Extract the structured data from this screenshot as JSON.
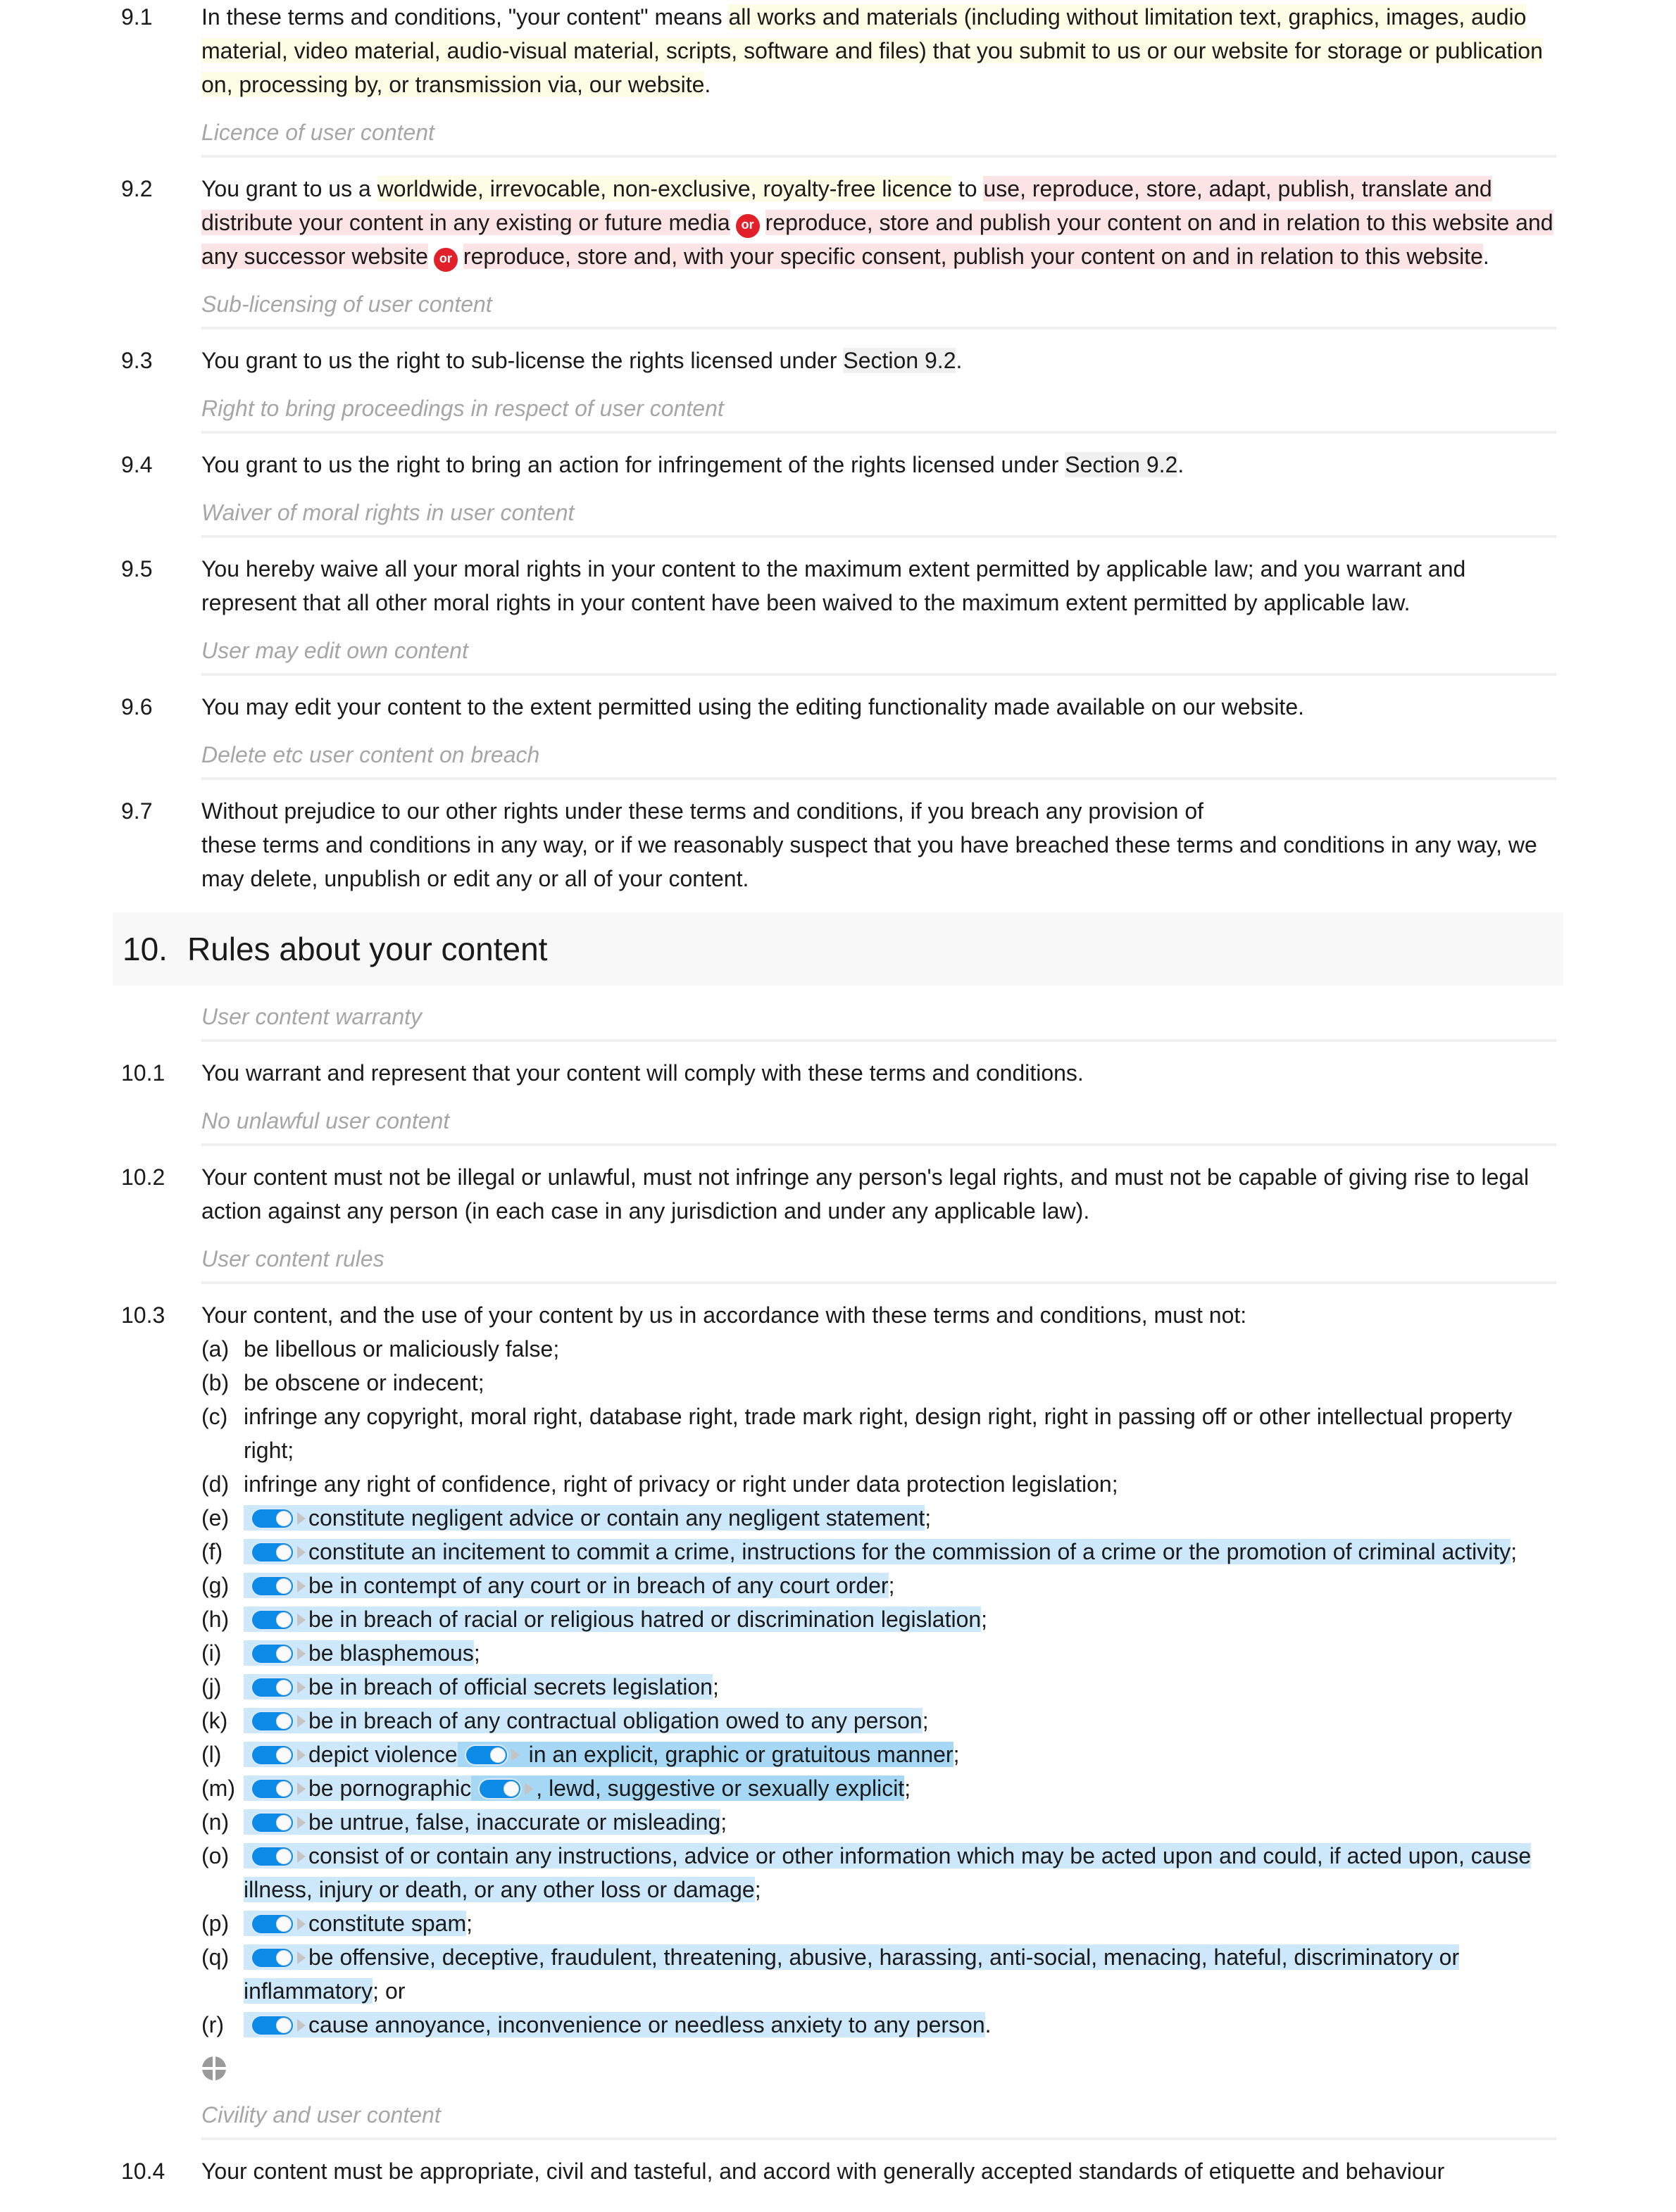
{
  "section9": {
    "clauses": [
      {
        "num": "9.1",
        "pre": "In these terms and conditions, \"your content\" means ",
        "hl": "all works and materials (including without limitation text, graphics, images, audio material, video material, audio-visual material, scripts, software and files) that you submit to us or our website for storage or publication on, processing by, or transmission via, our website",
        "post": "."
      },
      {
        "caption": "Licence of user content",
        "num": "9.2",
        "pre": "You grant to us a ",
        "hl_yellow": "worldwide, irrevocable, non-exclusive, royalty-free licence",
        "mid": " to ",
        "option1": "use, reproduce, store, adapt, publish, translate and distribute your content in any existing or future media",
        "or_label": "or",
        "option2": "reproduce, store and publish your content on and in relation to this website and any successor website",
        "option3": "reproduce, store and, with your specific consent, publish your content on and in relation to this website",
        "post": "."
      },
      {
        "caption": "Sub-licensing of user content",
        "num": "9.3",
        "pre": "You grant to us the right to sub-license the rights licensed under ",
        "xref": "Section 9.2",
        "post": "."
      },
      {
        "caption": "Right to bring proceedings in respect of user content",
        "num": "9.4",
        "pre": "You grant to us the right to bring an action for infringement of the rights licensed under ",
        "xref": "Section 9.2",
        "post": "."
      },
      {
        "caption": "Waiver of moral rights in user content",
        "num": "9.5",
        "text": "You hereby waive all your moral rights in your content to the maximum extent permitted by applicable law; and you warrant and represent that all other moral rights in your content have been waived to the maximum extent permitted by applicable law."
      },
      {
        "caption": "User may edit own content",
        "num": "9.6",
        "text": "You may edit your content to the extent permitted using the editing functionality made available on our website."
      },
      {
        "caption": "Delete etc user content on breach",
        "num": "9.7",
        "line1": "Without prejudice to our other rights under these terms and conditions, if you breach any provision of",
        "line2": "these terms and conditions in any way, or if we reasonably suspect that you have breached these terms and conditions in any way, we may delete, unpublish or edit any or all of your content."
      }
    ]
  },
  "section10": {
    "heading_num": "10.",
    "heading_title": "Rules about your content",
    "c1": {
      "caption": "User content warranty",
      "num": "10.1",
      "text": "You warrant and represent that your content will comply with these terms and conditions."
    },
    "c2": {
      "caption": "No unlawful user content",
      "num": "10.2",
      "text": "Your content must not be illegal or unlawful, must not infringe any person's legal rights, and must not be capable of giving rise to legal action against any person (in each case in any jurisdiction and under any applicable law)."
    },
    "c3": {
      "caption": "User content rules",
      "num": "10.3",
      "intro": "Your content, and the use of your content by us in accordance with these terms and conditions, must not:",
      "items": [
        {
          "label": "(a)",
          "text": "be libellous or maliciously false;"
        },
        {
          "label": "(b)",
          "text": "be obscene or indecent;"
        },
        {
          "label": "(c)",
          "text": "infringe any copyright, moral right, database right, trade mark right, design right, right in passing off or other intellectual property right;"
        },
        {
          "label": "(d)",
          "text": "infringe any right of confidence, right of privacy or right under data protection legislation;"
        },
        {
          "label": "(e)",
          "text": "constitute negligent advice or contain any negligent statement",
          "end": ";",
          "toggle_on": true
        },
        {
          "label": "(f)",
          "text": "constitute an incitement to commit a crime, instructions for the commission of a crime or the promotion of criminal activity",
          "end": ";",
          "toggle_on": true
        },
        {
          "label": "(g)",
          "text": "be in contempt of any court or in breach of any court order",
          "end": ";",
          "toggle_on": true
        },
        {
          "label": "(h)",
          "text": "be in breach of racial or religious hatred or discrimination legislation",
          "end": ";",
          "toggle_on": true
        },
        {
          "label": "(i)",
          "text": "be blasphemous",
          "end": ";",
          "toggle_on": true
        },
        {
          "label": "(j)",
          "text": "be in breach of official secrets legislation",
          "end": ";",
          "toggle_on": true
        },
        {
          "label": "(k)",
          "text": "be in breach of any contractual obligation owed to any person",
          "end": ";",
          "toggle_on": true
        },
        {
          "label": "(l)",
          "text": "depict violence",
          "nested": " in an explicit, graphic or gratuitous manner",
          "end": ";",
          "toggle_on": true
        },
        {
          "label": "(m)",
          "text": "be pornographic",
          "nested": ", lewd, suggestive or sexually explicit",
          "end": ";",
          "toggle_on": true
        },
        {
          "label": "(n)",
          "text": "be untrue, false, inaccurate or misleading",
          "end": ";",
          "toggle_on": true
        },
        {
          "label": "(o)",
          "text": "consist of or contain any instructions, advice or other information which may be acted upon and could, if acted upon, cause illness, injury or death, or any other loss or damage",
          "end": ";",
          "toggle_on": true
        },
        {
          "label": "(p)",
          "text": "constitute spam",
          "end": ";",
          "toggle_on": true
        },
        {
          "label": "(q)",
          "text": "be offensive, deceptive, fraudulent, threatening, abusive, harassing, anti-social, menacing, hateful, discriminatory or inflammatory",
          "end": "; or",
          "toggle_on": true
        },
        {
          "label": "(r)",
          "text": "cause annoyance, inconvenience or needless anxiety to any person",
          "end": ".",
          "toggle_on": true
        }
      ]
    },
    "add_icon": "add-clause-icon",
    "c4": {
      "caption": "Civility and user content",
      "num": "10.4",
      "text": "Your content must be appropriate, civil and tasteful, and accord with generally accepted standards of etiquette and behaviour"
    }
  },
  "colors": {
    "optional_highlight": "#fdfde6",
    "alternative_highlight": "#fce4e5",
    "toggle_highlight": "#cde8fa",
    "nested_toggle_highlight": "#a6d8f5",
    "or_badge": "#e2202a",
    "toggle_on": "#0b8be6"
  }
}
